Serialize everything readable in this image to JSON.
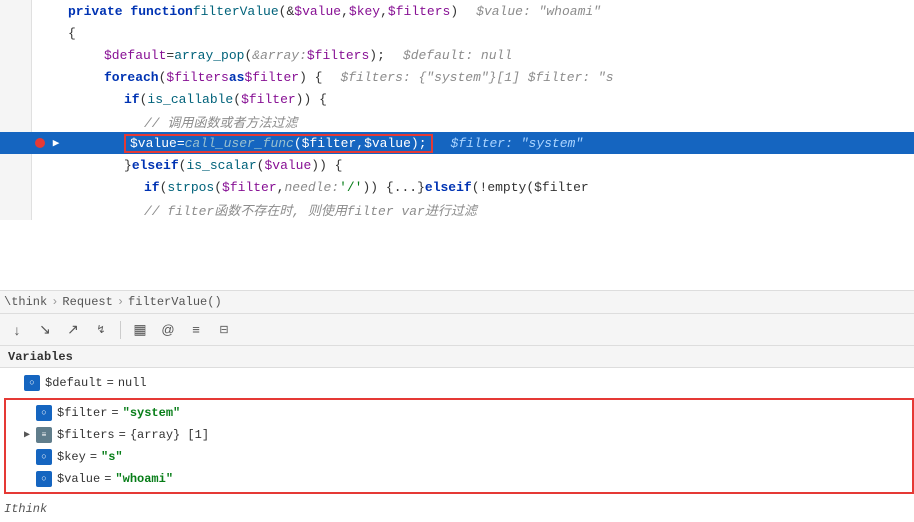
{
  "code": {
    "lines": [
      {
        "id": 1,
        "lineNum": "",
        "highlighted": false,
        "hasBreakpoint": false,
        "hasArrow": false,
        "indentLevel": 0,
        "content": "private_function_filterValue"
      },
      {
        "id": 2,
        "lineNum": "",
        "highlighted": false,
        "hasBreakpoint": false,
        "hasArrow": false,
        "indentLevel": 0,
        "content": "open_brace"
      },
      {
        "id": 3,
        "lineNum": "",
        "highlighted": false,
        "hasBreakpoint": false,
        "hasArrow": false,
        "indentLevel": 2,
        "content": "default_line"
      },
      {
        "id": 4,
        "lineNum": "",
        "highlighted": false,
        "hasBreakpoint": false,
        "hasArrow": false,
        "indentLevel": 2,
        "content": "foreach_line"
      },
      {
        "id": 5,
        "lineNum": "",
        "highlighted": false,
        "hasBreakpoint": false,
        "hasArrow": false,
        "indentLevel": 3,
        "content": "if_callable_line"
      },
      {
        "id": 6,
        "lineNum": "",
        "highlighted": false,
        "hasBreakpoint": false,
        "hasArrow": false,
        "indentLevel": 4,
        "content": "chinese_comment_1"
      },
      {
        "id": 7,
        "lineNum": "",
        "highlighted": true,
        "hasBreakpoint": true,
        "hasArrow": true,
        "indentLevel": 4,
        "content": "call_user_func_line"
      },
      {
        "id": 8,
        "lineNum": "",
        "highlighted": false,
        "hasBreakpoint": false,
        "hasArrow": false,
        "indentLevel": 3,
        "content": "elseif_scalar_line"
      },
      {
        "id": 9,
        "lineNum": "",
        "highlighted": false,
        "hasBreakpoint": false,
        "hasArrow": false,
        "indentLevel": 4,
        "content": "strpos_line"
      },
      {
        "id": 10,
        "lineNum": "",
        "highlighted": false,
        "hasBreakpoint": false,
        "hasArrow": false,
        "indentLevel": 4,
        "content": "chinese_comment_2"
      }
    ]
  },
  "breadcrumb": {
    "parts": [
      "\\think",
      "Request",
      "filterValue()"
    ]
  },
  "toolbar": {
    "buttons": [
      {
        "name": "step-over",
        "icon": "↓",
        "label": "Step Over"
      },
      {
        "name": "step-into",
        "icon": "↘",
        "label": "Step Into"
      },
      {
        "name": "step-out",
        "icon": "↗",
        "label": "Step Out"
      },
      {
        "name": "run-to-cursor",
        "icon": "↯",
        "label": "Run to Cursor"
      },
      {
        "name": "evaluate",
        "icon": "▦",
        "label": "Evaluate"
      },
      {
        "name": "watch",
        "icon": "@",
        "label": "Watch"
      },
      {
        "name": "breakpoints",
        "icon": "≡",
        "label": "Breakpoints"
      },
      {
        "name": "frames",
        "icon": "⊟",
        "label": "Frames"
      }
    ]
  },
  "variables": {
    "header": "Variables",
    "items": [
      {
        "id": 1,
        "type": "scalar",
        "name": "$default",
        "eq": "=",
        "value": "null",
        "valueType": "null",
        "indent": 0,
        "expanded": false,
        "selected": false
      },
      {
        "id": 2,
        "type": "scalar",
        "name": "$filter",
        "eq": "=",
        "value": "\"system\"",
        "valueType": "string",
        "indent": 0,
        "expanded": false,
        "selected": true,
        "outlined": true
      },
      {
        "id": 3,
        "type": "array",
        "name": "$filters",
        "eq": "=",
        "value": "{array} [1]",
        "valueType": "array",
        "indent": 0,
        "expanded": true,
        "selected": true,
        "outlined": true
      },
      {
        "id": 4,
        "type": "scalar",
        "name": "$key",
        "eq": "=",
        "value": "\"s\"",
        "valueType": "string",
        "indent": 0,
        "expanded": false,
        "selected": true,
        "outlined": true
      },
      {
        "id": 5,
        "type": "scalar",
        "name": "$value",
        "eq": "=",
        "value": "\"whoami\"",
        "valueType": "string",
        "indent": 0,
        "expanded": false,
        "selected": true,
        "outlined": true
      }
    ]
  },
  "syntax": {
    "line1_pre": "private function ",
    "line1_fn": "filterValue",
    "line1_params": "(&$value, $key, $filters)",
    "line1_hint": "$value: \"whoami\"",
    "line3_var1": "$default",
    "line3_fn": "array_pop",
    "line3_hint": "&array: $filters",
    "line3_var2": "$filters",
    "line3_hint2": "$default: null",
    "line4_kw": "foreach",
    "line4_params": "($filters as $filter)",
    "line4_hint": "$filters: {\"system\"}[1]  $filter: \"s",
    "line5_kw": "if",
    "line5_fn": "is_callable",
    "line5_param": "$filter",
    "line6_cmt": "// 调用函数或者方法过滤",
    "line7_var": "$value",
    "line7_fn": "call_user_func",
    "line7_params": "$filter, $value",
    "line7_hint": "$filter: \"system\"",
    "line8_kw1": "} elseif",
    "line8_fn": "is_scalar",
    "line8_param": "$value",
    "line9_fn": "strpos",
    "line9_params": "$filter,",
    "line9_hint": "needle: '/'",
    "line9_rest": "{...} elseif (!empty($filter",
    "line10_cmt": "// filter函数不存在时, 则使用filter var进行过滤"
  }
}
